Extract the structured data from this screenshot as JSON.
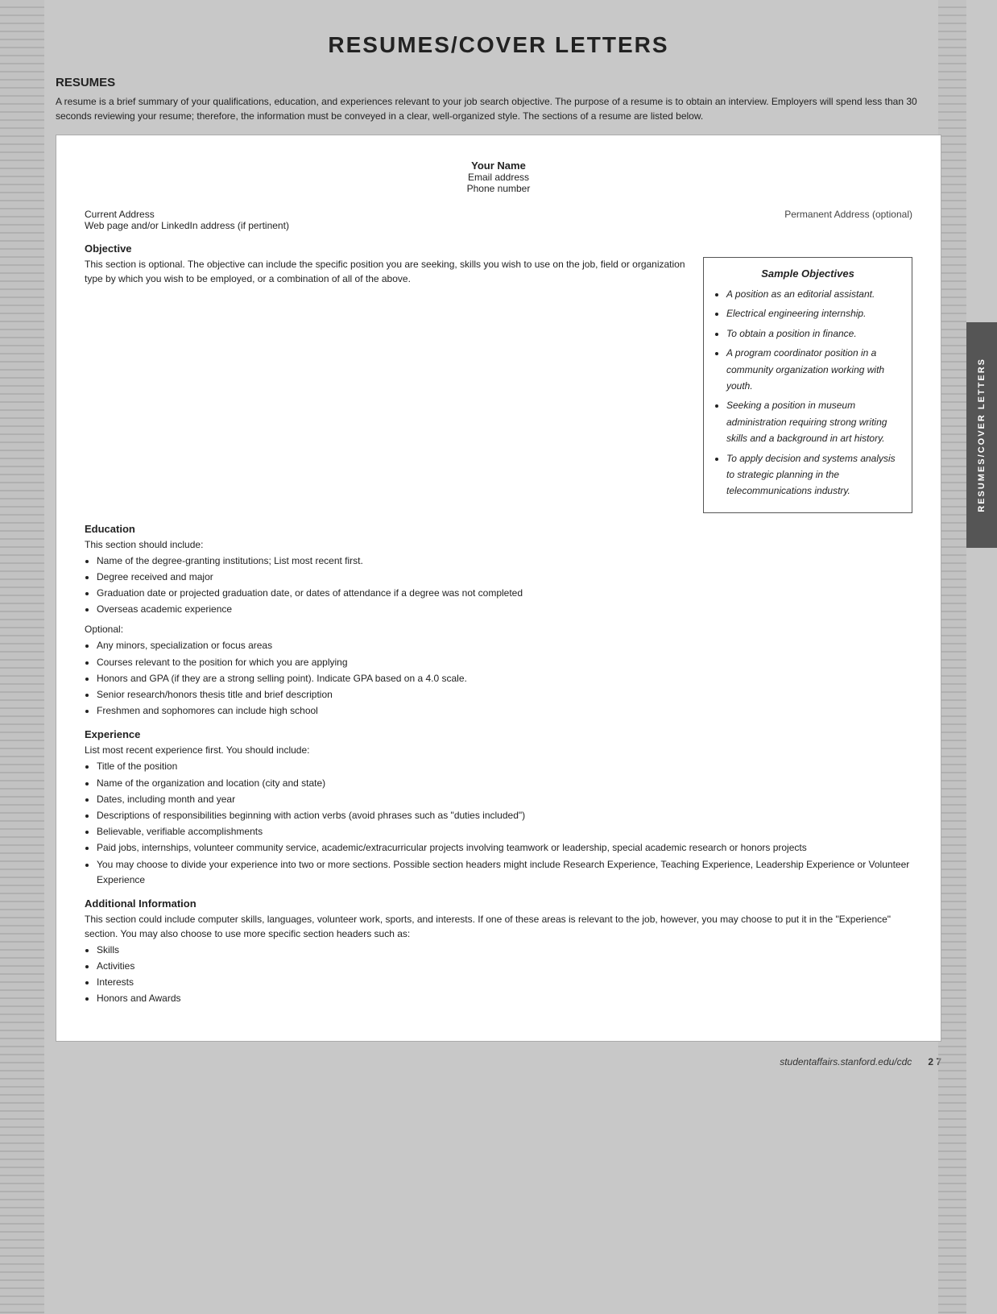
{
  "page": {
    "title": "RESUMES/COVER LETTERS",
    "side_tab": "RESUMES/COVER LETTERS"
  },
  "intro": {
    "heading": "RESUMES",
    "text": "A resume is a brief summary of your qualifications, education, and experiences relevant to your job search objective. The purpose of a resume is to obtain an interview. Employers will spend less than 30 seconds reviewing your resume; therefore, the information must be conveyed in a clear, well-organized style. The sections of a resume are listed below."
  },
  "resume": {
    "name": "Your Name",
    "email": "Email address",
    "phone": "Phone number",
    "current_address": "Current Address",
    "web": "Web page and/or LinkedIn address (if pertinent)",
    "permanent_address": "Permanent Address (optional)",
    "sections": {
      "objective": {
        "title": "Objective",
        "text": "This section is optional. The objective can include the specific position you are seeking, skills you wish to use on the job, field or organization type by which you wish to be employed, or a combination of all of the above."
      },
      "education": {
        "title": "Education",
        "intro": "This section should include:",
        "items": [
          "Name of the degree-granting institutions; List most recent first.",
          "Degree received and major",
          "Graduation date or projected graduation date, or dates of attendance if a degree was not completed",
          "Overseas academic experience"
        ],
        "optional_label": "Optional:",
        "optional_items": [
          "Any minors, specialization or focus areas",
          "Courses relevant to the position for which you are applying",
          "Honors and GPA (if they are a strong selling point). Indicate GPA based on a 4.0 scale.",
          "Senior research/honors thesis title and brief description",
          "Freshmen and sophomores can include high school"
        ]
      },
      "experience": {
        "title": "Experience",
        "intro": "List most recent experience first. You should include:",
        "items": [
          "Title of the position",
          "Name of the organization and location (city and state)",
          "Dates, including month and year",
          "Descriptions of responsibilities beginning with action verbs (avoid phrases such as \"duties included\")",
          "Believable, verifiable accomplishments",
          "Paid jobs, internships, volunteer community service, academic/extracurricular projects involving teamwork or leadership, special academic research or honors projects",
          "You may choose to divide your experience into two or more sections. Possible section headers might include Research Experience, Teaching Experience, Leadership Experience or Volunteer Experience"
        ]
      },
      "additional": {
        "title": "Additional Information",
        "text": "This section could include computer skills, languages, volunteer work, sports, and interests. If one of these areas is relevant to the job, however, you may choose to put it in the \"Experience\" section. You may also choose to use more specific section headers such as:",
        "items": [
          "Skills",
          "Activities",
          "Interests",
          "Honors and Awards"
        ]
      }
    }
  },
  "sample_objectives": {
    "title": "Sample Objectives",
    "items": [
      "A position as an editorial assistant.",
      "Electrical engineering internship.",
      "To obtain a position in finance.",
      "A program coordinator position in a community organization working with youth.",
      "Seeking a position in museum administration requiring strong writing skills and a background in art history.",
      "To apply decision and systems analysis to strategic planning in the telecommunications industry."
    ]
  },
  "footer": {
    "url": "studentaffairs.stanford.edu/cdc",
    "page": "2 7"
  }
}
